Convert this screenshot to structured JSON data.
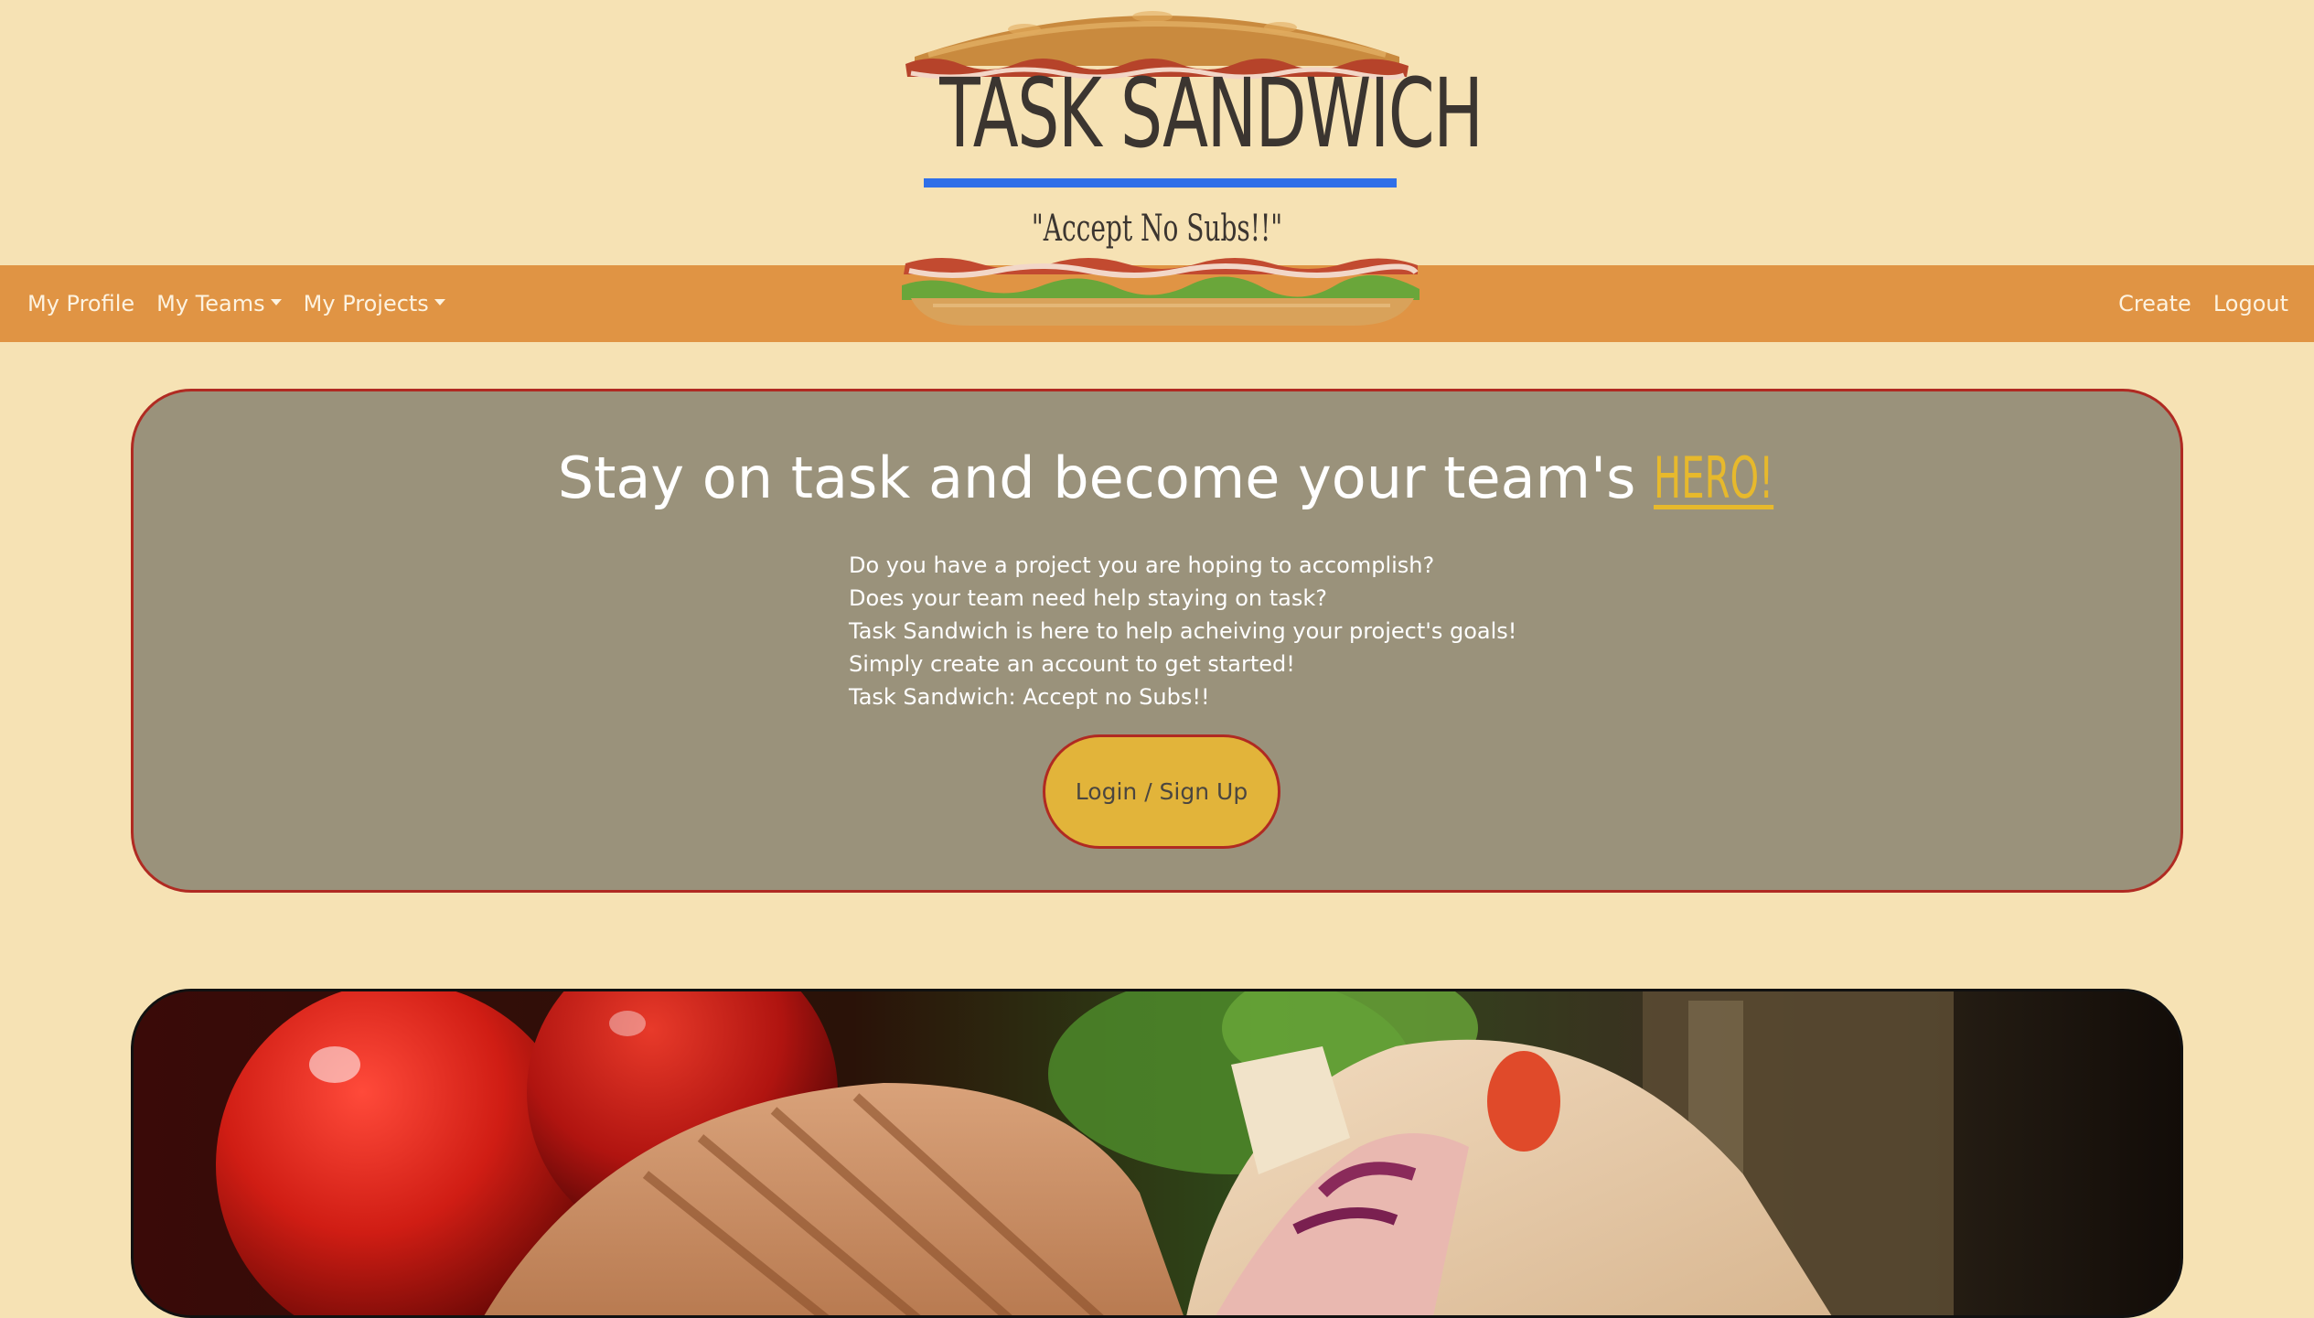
{
  "nav": {
    "left": [
      {
        "label": "My Profile",
        "dropdown": false
      },
      {
        "label": "My Teams",
        "dropdown": true
      },
      {
        "label": "My Projects",
        "dropdown": true
      }
    ],
    "right": [
      {
        "label": "Create"
      },
      {
        "label": "Logout"
      }
    ]
  },
  "logo": {
    "title": "TASK SANDWICH",
    "motto": "\"Accept No Subs!!\""
  },
  "hero": {
    "heading": "Stay on task and become your team's ",
    "heading_highlight": "HERO!",
    "lines": [
      "Do you have a project you are hoping to accomplish?",
      "Does your team need help staying on task?",
      "Task Sandwich is here to help acheiving your project's goals!",
      "Simply create an account to get started!",
      "Task Sandwich: Accept no Subs!!"
    ],
    "button_label": "Login / Sign Up"
  },
  "colors": {
    "page_bg": "#f6e2b4",
    "navbar_bg": "#e09444",
    "hero_bg": "#9a927b",
    "hero_border": "#b02a22",
    "accent_yellow": "#e7b92c",
    "button_bg": "#e2b43a",
    "logo_underline": "#2f6fe8"
  }
}
